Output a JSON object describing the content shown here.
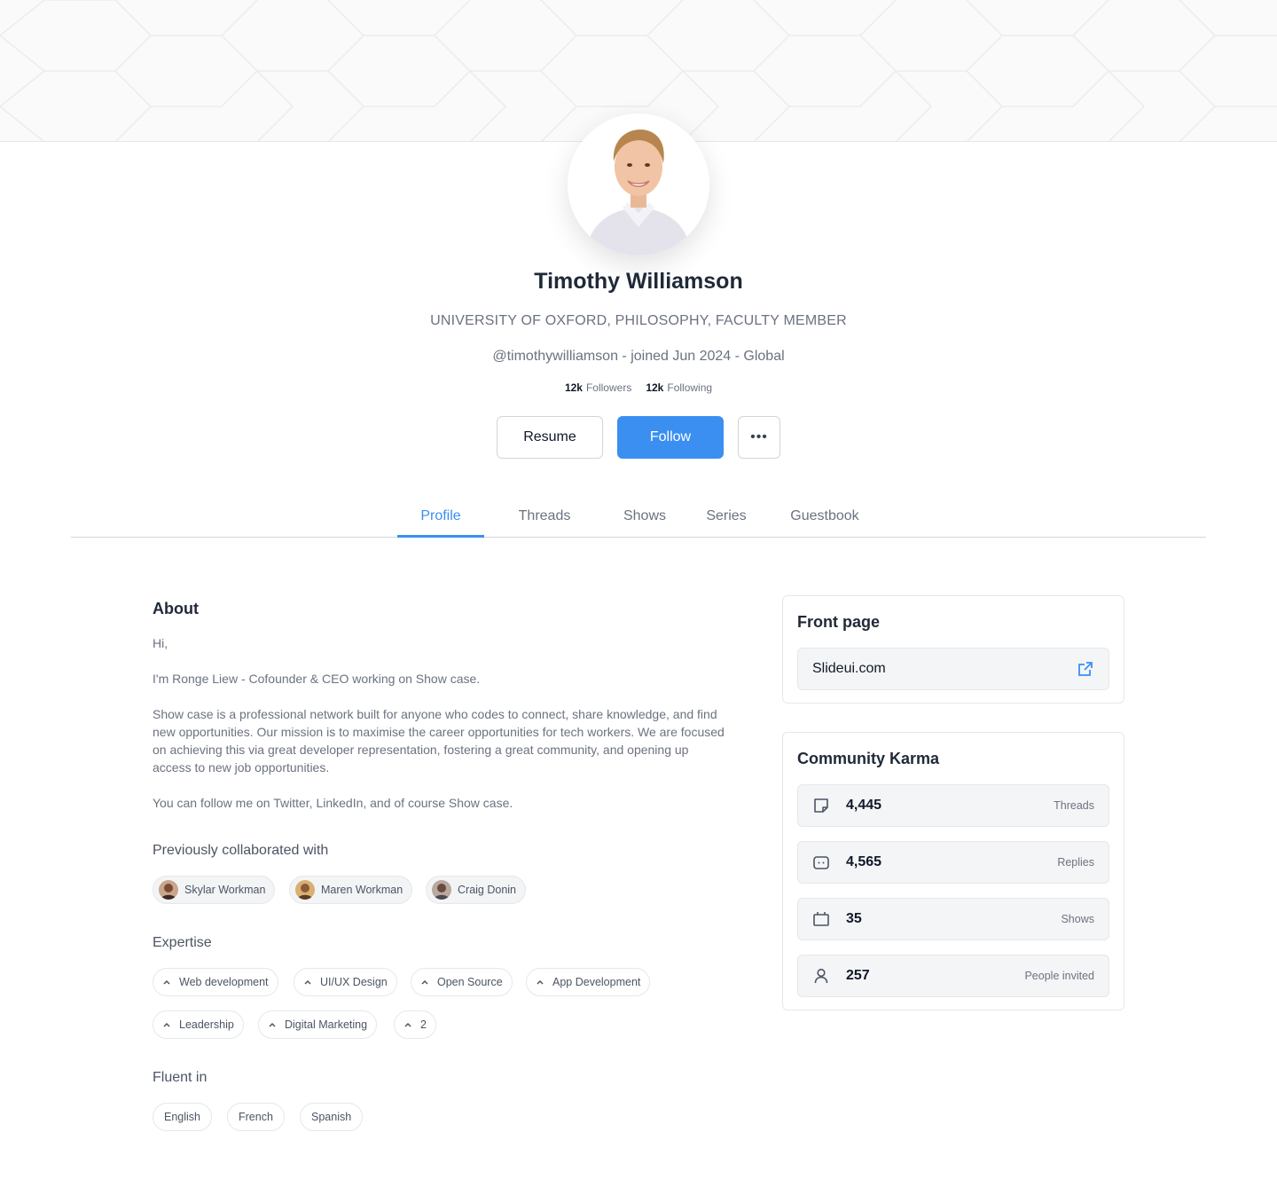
{
  "profile": {
    "name": "Timothy Williamson",
    "subtitle": "UNIVERSITY OF OXFORD, PHILOSOPHY, FACULTY MEMBER",
    "handle_line": "@timothywilliamson - joined Jun 2024 - Global",
    "followers_count": "12k",
    "followers_label": "Followers",
    "following_count": "12k",
    "following_label": "Following"
  },
  "actions": {
    "resume_label": "Resume",
    "follow_label": "Follow",
    "more_label": "•••"
  },
  "tabs": [
    {
      "label": "Profile",
      "active": true
    },
    {
      "label": "Threads",
      "active": false
    },
    {
      "label": "Shows",
      "active": false
    },
    {
      "label": "Series",
      "active": false
    },
    {
      "label": "Guestbook",
      "active": false
    }
  ],
  "about": {
    "title": "About",
    "paragraphs": [
      "Hi,",
      "I'm Ronge Liew - Cofounder & CEO working on Show case.",
      "Show case is a professional network built for anyone who codes to connect, share knowledge, and find new opportunities. Our mission is to maximise the career opportunities for tech workers. We are focused on achieving this via great developer representation, fostering a great community, and opening up access to new job opportunities.",
      "You can follow me on Twitter, LinkedIn, and of course Show case."
    ]
  },
  "collaborators": {
    "title": "Previously collaborated with",
    "people": [
      "Skylar Workman",
      "Maren Workman",
      "Craig Donin"
    ]
  },
  "expertise": {
    "title": "Expertise",
    "items": [
      "Web development",
      "UI/UX Design",
      "Open Source",
      "App Development",
      "Leadership",
      "Digital Marketing",
      "2"
    ]
  },
  "fluent": {
    "title": "Fluent in",
    "languages": [
      "English",
      "French",
      "Spanish"
    ]
  },
  "front_page": {
    "title": "Front page",
    "link": "Slideui.com",
    "link_icon": "external-link-icon"
  },
  "karma": {
    "title": "Community Karma",
    "rows": [
      {
        "icon": "note-icon",
        "value": "4,445",
        "label": "Threads"
      },
      {
        "icon": "chat-icon",
        "value": "4,565",
        "label": "Replies"
      },
      {
        "icon": "tv-icon",
        "value": "35",
        "label": "Shows"
      },
      {
        "icon": "user-icon",
        "value": "257",
        "label": "People invited"
      }
    ]
  },
  "colors": {
    "accent": "#3b8ff0",
    "text_primary": "#1f2937",
    "text_muted": "#6b7280",
    "border": "#e5e7eb"
  }
}
